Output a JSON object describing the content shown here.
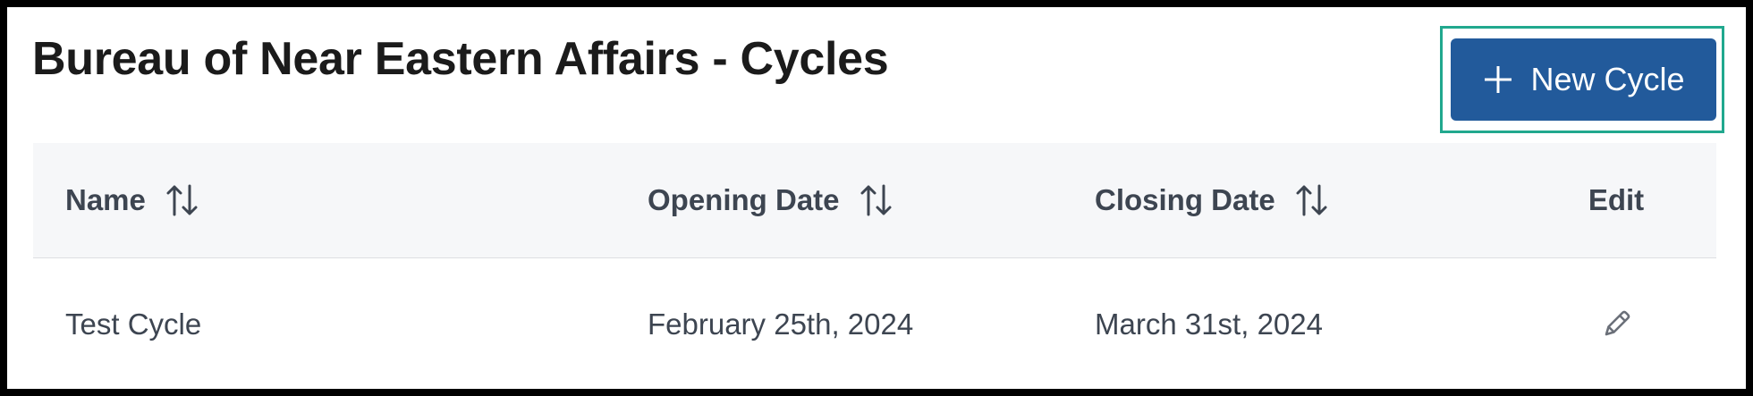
{
  "page": {
    "title": "Bureau of Near Eastern Affairs - Cycles"
  },
  "toolbar": {
    "new_cycle_label": "New Cycle",
    "new_cycle_icon": "plus-icon"
  },
  "table": {
    "columns": [
      {
        "label": "Name",
        "sortable": true,
        "sort_icon": "sort-arrows-icon"
      },
      {
        "label": "Opening Date",
        "sortable": true,
        "sort_icon": "sort-arrows-icon"
      },
      {
        "label": "Closing Date",
        "sortable": true,
        "sort_icon": "sort-arrows-icon"
      },
      {
        "label": "Edit",
        "sortable": false
      }
    ],
    "rows": [
      {
        "name": "Test Cycle",
        "opening_date": "February 25th, 2024",
        "closing_date": "March 31st, 2024",
        "edit_icon": "pencil-icon"
      }
    ]
  },
  "colors": {
    "title_text": "#1b1b1b",
    "table_text": "#3d4551",
    "button_background": "#225a9b",
    "button_text": "#ffffff",
    "focus_ring": "#21a88e",
    "header_background": "#f6f7f9"
  }
}
